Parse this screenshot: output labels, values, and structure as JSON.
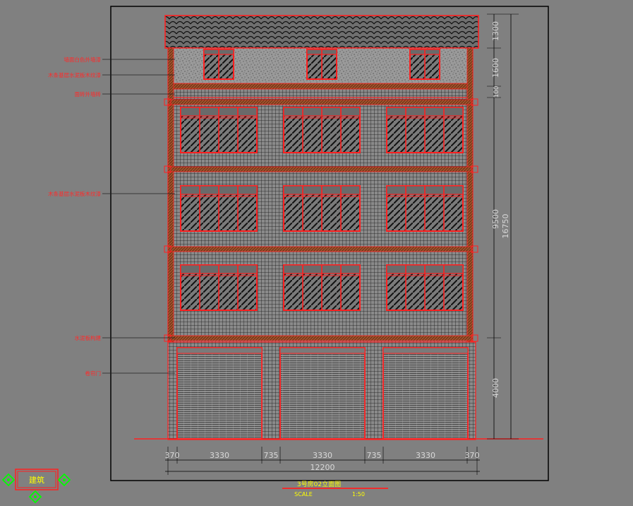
{
  "drawing": {
    "title": "3号房02立面图",
    "scale_label": "SCALE",
    "scale_value": "1:50",
    "layer_tag": "建筑"
  },
  "annotations": [
    {
      "label": "墙面白色外墙漆"
    },
    {
      "label": "木条基层水泥板木纹漆"
    },
    {
      "label": "面砖外墙砖"
    },
    {
      "label": "木条基层水泥板木纹漆"
    },
    {
      "label": "水泥板构建"
    },
    {
      "label": "卷帘门"
    }
  ],
  "dimensions": {
    "vertical_inner": [
      "1300",
      "1600",
      "100",
      "9500",
      "4000"
    ],
    "vertical_total": "16750",
    "horizontal": [
      "370",
      "3330",
      "735",
      "3330",
      "735",
      "3330",
      "370"
    ],
    "horizontal_total": "12200"
  },
  "colors": {
    "background": "#808080",
    "line": "#000000",
    "accent": "#ff2020",
    "annotation_text": "#ff2a2a",
    "dimension_text": "#d8d8d8",
    "title_text": "#ffff00",
    "gizmo": "#00ff00"
  }
}
